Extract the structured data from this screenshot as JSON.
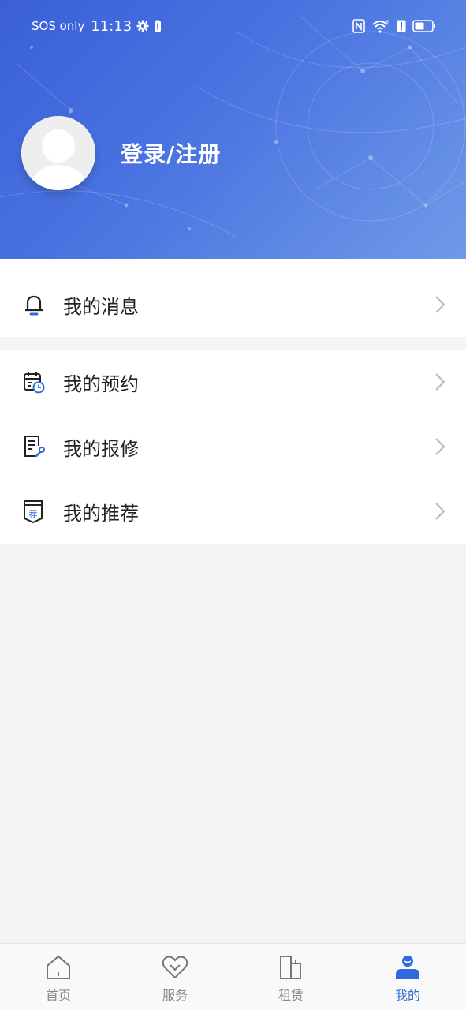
{
  "status_bar": {
    "carrier": "SOS only",
    "time": "11:13",
    "signal_label": "6"
  },
  "profile": {
    "login_label": "登录/注册"
  },
  "menu": {
    "messages": "我的消息",
    "appointments": "我的预约",
    "repairs": "我的报修",
    "recommendations": "我的推荐",
    "recommend_icon_char": "荐"
  },
  "tabs": [
    {
      "label": "首页",
      "icon": "home-icon",
      "active": false
    },
    {
      "label": "服务",
      "icon": "heart-service-icon",
      "active": false
    },
    {
      "label": "租赁",
      "icon": "building-icon",
      "active": false
    },
    {
      "label": "我的",
      "icon": "user-icon",
      "active": true
    }
  ],
  "colors": {
    "header_start": "#3a5fd8",
    "header_end": "#6f9ae8",
    "active_tab": "#2f6bdc",
    "page_bg": "#f4f4f4"
  }
}
